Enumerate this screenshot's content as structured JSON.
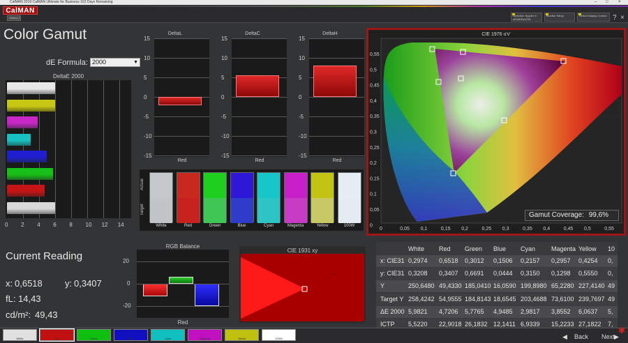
{
  "titlebar": {
    "text": "CalMAN 2019 CalMAN Ultimate for Business 162 Days Remaining",
    "min": "–",
    "max": "□",
    "close": "×"
  },
  "app": {
    "logo": "CalMAN",
    "history_tab": "History 1"
  },
  "header": {
    "source": "Selection Spyder 5 · sRGB/Rec709",
    "display": "Monitor Setup",
    "display_control": "Select Display Control"
  },
  "window_controls": {
    "help": "?",
    "close": "×"
  },
  "page_title": "Color Gamut",
  "de_formula": {
    "label": "dE Formula:",
    "value": "2000"
  },
  "de_chart": {
    "title": "DeltaE 2000",
    "x_ticks": [
      "0",
      "2",
      "4",
      "6",
      "8",
      "10",
      "12",
      "14"
    ],
    "bars": [
      {
        "name": "White",
        "value": 5.98,
        "color": "#e8e8e8"
      },
      {
        "name": "Yellow",
        "value": 6.06,
        "color": "#c7c714"
      },
      {
        "name": "Magenta",
        "value": 3.86,
        "color": "#c728c7"
      },
      {
        "name": "Cyan",
        "value": 2.98,
        "color": "#19c2c2"
      },
      {
        "name": "Blue",
        "value": 4.95,
        "color": "#1f1fcf"
      },
      {
        "name": "Green",
        "value": 5.78,
        "color": "#19bf19"
      },
      {
        "name": "Red",
        "value": 4.72,
        "color": "#c71414"
      },
      {
        "name": "100W",
        "value": 5.98,
        "color": "#d9d9d9"
      }
    ]
  },
  "delta_charts": [
    {
      "title": "DeltaL",
      "label": "Red",
      "value": -2.2,
      "yticks": [
        "15",
        "10",
        "5",
        "0",
        "-5",
        "-10",
        "-15"
      ]
    },
    {
      "title": "DeltaC",
      "label": "Red",
      "value": 5.6,
      "yticks": [
        "15",
        "10",
        "5",
        "0",
        "-5",
        "-10",
        "-15"
      ]
    },
    {
      "title": "DeltaH",
      "label": "Red",
      "value": 8.0,
      "yticks": [
        "15",
        "10",
        "5",
        "0",
        "-5",
        "-10",
        "-15"
      ]
    }
  ],
  "swatches": {
    "actual_label": "Actual",
    "target_label": "Target",
    "items": [
      {
        "name": "White",
        "actual": "#c5c8ca",
        "target": "#c2c5c7"
      },
      {
        "name": "Red",
        "actual": "#c8281e",
        "target": "#c8221e"
      },
      {
        "name": "Green",
        "actual": "#1fcf20",
        "target": "#40c654"
      },
      {
        "name": "Blue",
        "actual": "#2d18d8",
        "target": "#2f3bc9"
      },
      {
        "name": "Cyan",
        "actual": "#16c6c8",
        "target": "#2ec5c6"
      },
      {
        "name": "Magenta",
        "actual": "#c61ec8",
        "target": "#c83bc4"
      },
      {
        "name": "Yellow",
        "actual": "#c2c414",
        "target": "#c6c964"
      },
      {
        "name": "100W",
        "actual": "#e4eef4",
        "target": "#e3ecf0"
      }
    ]
  },
  "cie1976": {
    "title": "CIE 1976 u'v'",
    "x_ticks": [
      "0",
      "0,05",
      "0,1",
      "0,15",
      "0,2",
      "0,25",
      "0,3",
      "0,35",
      "0,4",
      "0,45",
      "0,5",
      "0,55"
    ],
    "y_ticks": [
      "0,55",
      "0,5",
      "0,45",
      "0,4",
      "0,35",
      "0,3",
      "0,25",
      "0,2",
      "0,15",
      "0,1",
      "0,05",
      "0"
    ],
    "gamut_coverage_label": "Gamut Coverage:",
    "gamut_coverage_value": "99,6%"
  },
  "current_reading": {
    "title": "Current Reading",
    "x_label": "x:",
    "x_value": "0,6518",
    "y_label": "y:",
    "y_value": "0,3407",
    "fl_label": "fL:",
    "fl_value": "14,43",
    "cd_label": "cd/m²:",
    "cd_value": "49,43"
  },
  "rgb_balance": {
    "title": "RGB Balance",
    "label": "Red",
    "y_ticks": [
      "20",
      "0",
      "-20"
    ],
    "values": {
      "red": -11,
      "green": 6,
      "blue": -20
    }
  },
  "cie1931": {
    "title": "CIE 1931 xy"
  },
  "table": {
    "headers": [
      "",
      "White",
      "Red",
      "Green",
      "Blue",
      "Cyan",
      "Magenta",
      "Yellow",
      "10"
    ],
    "rows": [
      [
        "x: CIE31",
        "0,2974",
        "0,6518",
        "0,3012",
        "0,1506",
        "0,2157",
        "0,2957",
        "0,4254",
        "0,"
      ],
      [
        "y: CIE31",
        "0,3208",
        "0,3407",
        "0,6691",
        "0,0444",
        "0,3150",
        "0,1298",
        "0,5550",
        "0,"
      ],
      [
        "Y",
        "250,6480",
        "49,4330",
        "185,0410",
        "16,0590",
        "199,8980",
        "65,2280",
        "227,4140",
        "49"
      ],
      [
        "Target Y",
        "258,4242",
        "54,9555",
        "184,8143",
        "18,6545",
        "203,4688",
        "73,6100",
        "239,7697",
        "49"
      ],
      [
        "ΔE 2000",
        "5,9821",
        "4,7206",
        "5,7765",
        "4,9485",
        "2,9817",
        "3,8552",
        "6,0637",
        "5,"
      ],
      [
        "ICTP",
        "5,5220",
        "22,9018",
        "26,1832",
        "12,1411",
        "6,9339",
        "15,2233",
        "27,1822",
        "7,"
      ]
    ]
  },
  "patch_bar": [
    {
      "label": "White",
      "color": "#e0e0e0"
    },
    {
      "label": "Red",
      "color": "#c01010"
    },
    {
      "label": "Green",
      "color": "#10c010"
    },
    {
      "label": "Blue",
      "color": "#1010c0"
    },
    {
      "label": "Cyan",
      "color": "#10c0c0"
    },
    {
      "label": "Magenta",
      "color": "#c010c0"
    },
    {
      "label": "Yellow",
      "color": "#c0c010"
    },
    {
      "label": "100W",
      "color": "#ffffff"
    }
  ],
  "nav": {
    "back": "Back",
    "next": "Next"
  }
}
